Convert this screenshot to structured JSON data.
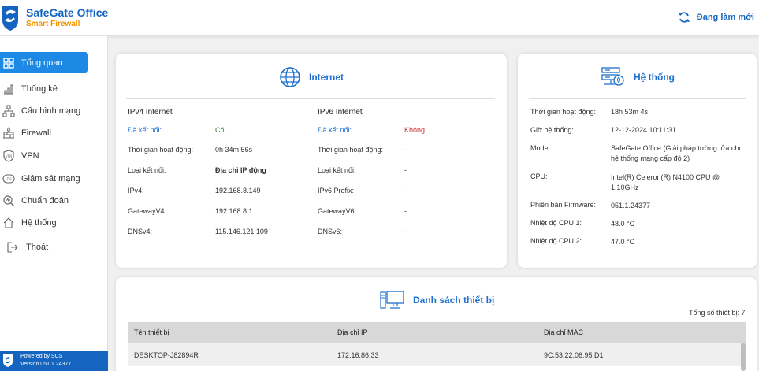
{
  "header": {
    "brand_title": "SafeGate Office",
    "brand_subtitle": "Smart Firewall",
    "refresh_label": "Đang làm mới",
    "icons": {
      "logo": "safegate-logo",
      "refresh": "refresh-icon"
    }
  },
  "sidebar": {
    "items": [
      {
        "label": "Tổng quan",
        "icon": "dashboard-icon",
        "active": true
      },
      {
        "label": "Thống kê",
        "icon": "bar-chart-icon"
      },
      {
        "label": "Cấu hình mạng",
        "icon": "network-icon"
      },
      {
        "label": "Firewall",
        "icon": "firewall-icon"
      },
      {
        "label": "VPN",
        "icon": "shield-vpn-icon"
      },
      {
        "label": "Giám sát mạng",
        "icon": "ids-icon"
      },
      {
        "label": "Chuẩn đoán",
        "icon": "magnifier-icon"
      },
      {
        "label": "Hệ thống",
        "icon": "home-icon"
      },
      {
        "label": "Thoát",
        "icon": "logout-icon"
      }
    ],
    "footer": {
      "line1": "Powered by SCS",
      "line2": "Version 051.1.24377"
    }
  },
  "internet": {
    "title": "Internet",
    "ipv4": {
      "heading": "IPv4 Internet",
      "rows": [
        {
          "label": "Đã kết nối:",
          "value": "Có"
        },
        {
          "label": "Thời gian hoạt động:",
          "value": "0h 34m 56s"
        },
        {
          "label": "Loại kết nối:",
          "value": "Địa chỉ IP động"
        },
        {
          "label": "IPv4:",
          "value": "192.168.8.149"
        },
        {
          "label": "GatewayV4:",
          "value": "192.168.8.1"
        },
        {
          "label": "DNSv4:",
          "value": "115.146.121.109"
        }
      ]
    },
    "ipv6": {
      "heading": "IPv6 Internet",
      "rows": [
        {
          "label": "Đã kết nối:",
          "value": "Không"
        },
        {
          "label": "Thời gian hoạt động:",
          "value": "-"
        },
        {
          "label": "Loại kết nối:",
          "value": "-"
        },
        {
          "label": "IPv6 Prefix:",
          "value": "-"
        },
        {
          "label": "GatewayV6:",
          "value": "-"
        },
        {
          "label": "DNSv6:",
          "value": "-"
        }
      ]
    }
  },
  "system": {
    "title": "Hệ thống",
    "rows": [
      {
        "label": "Thời gian hoạt động:",
        "value": "18h 53m 4s"
      },
      {
        "label": "Giờ hệ thống:",
        "value": "12-12-2024 10:11:31"
      },
      {
        "label": "Model:",
        "value": "SafeGate Office (Giải pháp tường lửa cho hệ thống mạng cấp độ 2)"
      },
      {
        "label": "CPU:",
        "value": "Intel(R) Celeron(R) N4100 CPU @ 1.10GHz"
      },
      {
        "label": "Phiên bản Firmware:",
        "value": "051.1.24377"
      },
      {
        "label": "Nhiệt độ CPU 1:",
        "value": "48.0 °C"
      },
      {
        "label": "Nhiệt độ CPU 2:",
        "value": "47.0 °C"
      }
    ]
  },
  "devices": {
    "title": "Danh sách thiết bị",
    "total": "Tổng số thiết bị: 7",
    "columns": [
      "Tên thiết bị",
      "Địa chỉ IP",
      "Địa chỉ MAC"
    ],
    "rows": [
      [
        "DESKTOP-J82894R",
        "172.16.86.33",
        "9C:53:22:06:95:D1"
      ]
    ]
  },
  "colors": {
    "accent": "#1e88e5",
    "brand": "#1565c0",
    "orange": "#f29100",
    "ok": "#2e7d32",
    "bad": "#d32f2f"
  }
}
